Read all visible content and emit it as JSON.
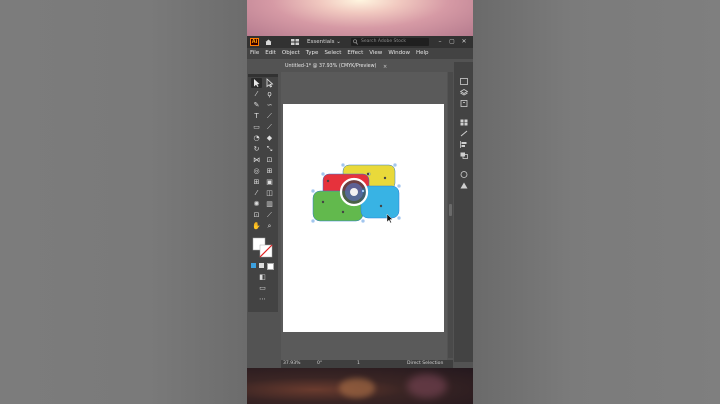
{
  "app": {
    "logo": "Ai",
    "workspace": "Essentials",
    "search_placeholder": "Search Adobe Stock",
    "window_buttons": [
      "–",
      "▢",
      "✕"
    ]
  },
  "menu": [
    "File",
    "Edit",
    "Object",
    "Type",
    "Select",
    "Effect",
    "View",
    "Window",
    "Help"
  ],
  "document": {
    "tab_title": "Untitled-1* @ 37.93% (CMYK/Preview)",
    "tab_close": "×"
  },
  "tools": [
    "selection-tool",
    "direct-selection-tool",
    "magic-wand-tool",
    "lasso-tool",
    "pen-tool",
    "curvature-tool",
    "type-tool",
    "line-tool",
    "rectangle-tool",
    "paintbrush-tool",
    "shaper-tool",
    "eraser-tool",
    "rotate-tool",
    "scale-tool",
    "width-tool",
    "free-transform-tool",
    "shape-builder-tool",
    "perspective-tool",
    "mesh-tool",
    "gradient-tool",
    "eyedropper-tool",
    "blend-tool",
    "symbol-sprayer-tool",
    "column-graph-tool",
    "artboard-tool",
    "slice-tool",
    "hand-tool",
    "zoom-tool"
  ],
  "status": {
    "zoom": "37.93%",
    "rotation": "0°",
    "page": "1",
    "tool": "Direct Selection"
  },
  "colors": {
    "shape_yellow": "#e9d93a",
    "shape_red": "#e6323c",
    "shape_green": "#62b94d",
    "shape_blue": "#38b3e4",
    "selection": "#2a7dd9"
  }
}
